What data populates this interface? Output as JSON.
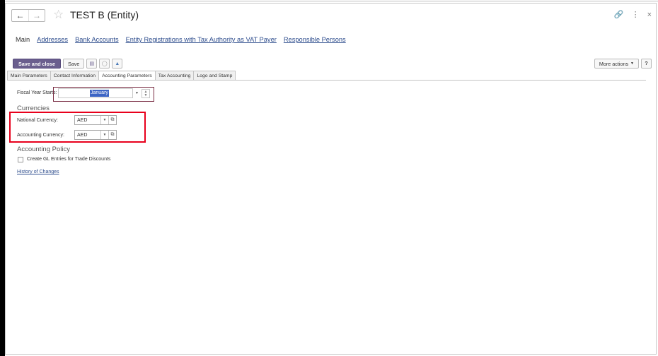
{
  "window": {
    "title": "TEST B (Entity)"
  },
  "top_nav": {
    "links": [
      "Main",
      "Addresses",
      "Bank Accounts",
      "Entity Registrations with Tax Authority as VAT Payer",
      "Responsible Persons"
    ],
    "active": "Main"
  },
  "toolbar": {
    "save_close_label": "Save and close",
    "save_label": "Save",
    "more_actions_label": "More actions",
    "help_label": "?"
  },
  "tabs": {
    "items": [
      "Main Parameters",
      "Contact Information",
      "Accounting Parameters",
      "Tax Accounting",
      "Logo and Stamp"
    ],
    "active": "Accounting Parameters"
  },
  "form": {
    "fiscal_year": {
      "label": "Fiscal Year Starts:",
      "value": "January"
    },
    "currencies_title": "Currencies",
    "national_currency": {
      "label": "National Currency:",
      "value": "AED"
    },
    "accounting_currency": {
      "label": "Accounting Currency:",
      "value": "AED"
    },
    "accounting_policy_title": "Accounting Policy",
    "gl_entries": {
      "label": "Create GL Entries for Trade Discounts",
      "checked": false
    },
    "history_link": "History of Changes"
  },
  "icons": {
    "back": "arrow-left-icon",
    "forward": "arrow-right-icon",
    "favorite": "star-icon",
    "link": "link-icon",
    "menu": "vertical-dots-icon",
    "close": "close-icon"
  },
  "colors": {
    "primary_button": "#6a5e8e",
    "link": "#2f4e8e",
    "highlight_box": "#e8001c",
    "focus_outline": "#7b2f45",
    "selection": "#3c64c4"
  }
}
